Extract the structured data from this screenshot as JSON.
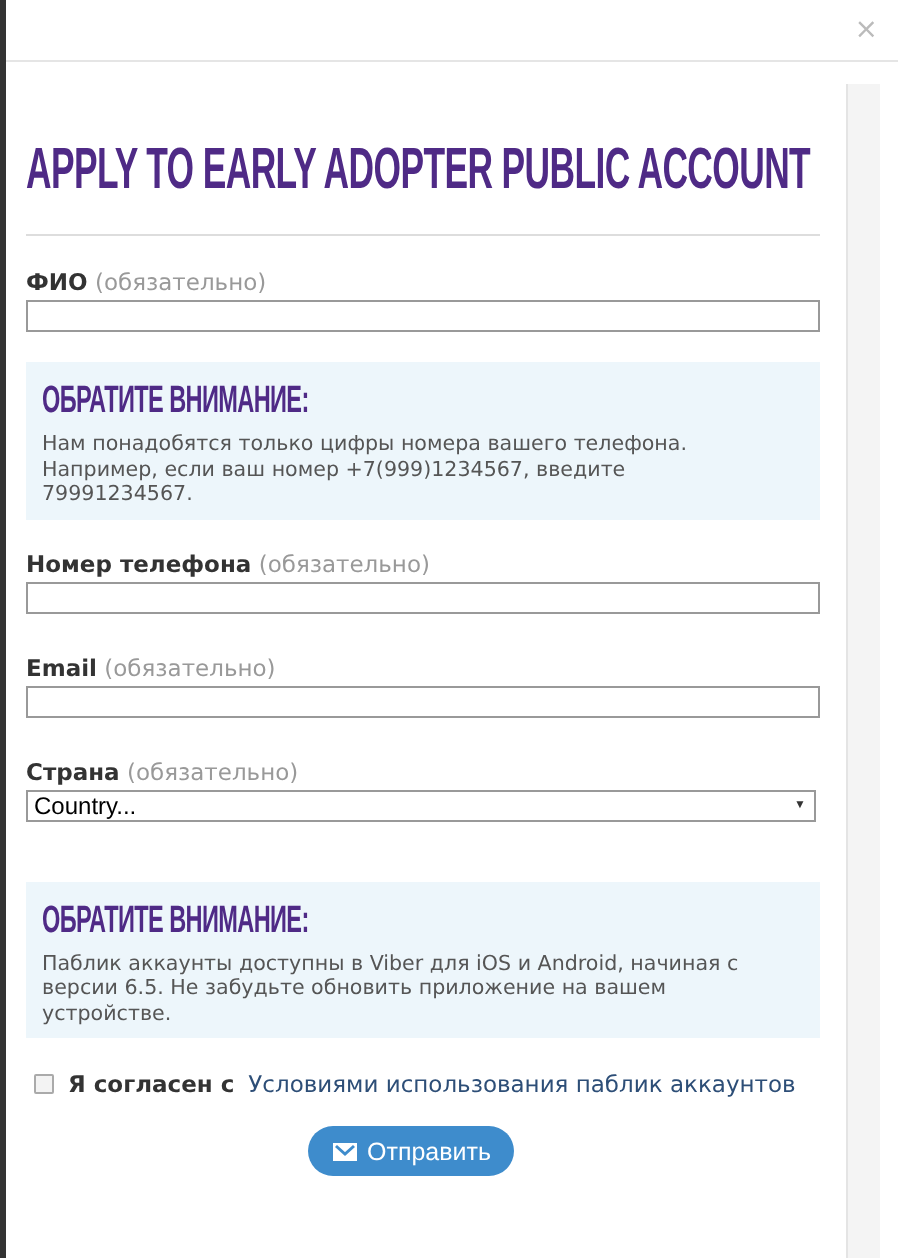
{
  "dialog": {
    "close": "×",
    "title": "APPLY TO EARLY ADOPTER PUBLIC ACCOUNT"
  },
  "sections": [
    {
      "kind": "field",
      "label": "ФИО",
      "hint": "(обязательно)"
    },
    {
      "kind": "notice",
      "heading": "ОБРАТИТЕ ВНИМАНИЕ:",
      "text": "Нам понадобятся только цифры номера вашего телефона. Например, если ваш номер +7(999)1234567, введите 79991234567."
    },
    {
      "kind": "field",
      "label": "Номер телефона",
      "hint": "(обязательно)"
    },
    {
      "kind": "field",
      "label": "Email",
      "hint": "(обязательно)"
    },
    {
      "kind": "select",
      "label": "Страна",
      "hint": "(обязательно)",
      "value": "Country...",
      "arrow": "▼"
    },
    {
      "kind": "notice",
      "heading": "ОБРАТИТЕ ВНИМАНИЕ:",
      "text": "Паблик аккаунты доступны в Viber для iOS и Android, начиная с версии 6.5. Не забудьте обновить приложение на вашем устройстве."
    }
  ],
  "agreement": {
    "checked": false,
    "label": "Я согласен с",
    "link": "Условиями использования паблик аккаунтов"
  },
  "submit": {
    "label": "Отправить"
  }
}
